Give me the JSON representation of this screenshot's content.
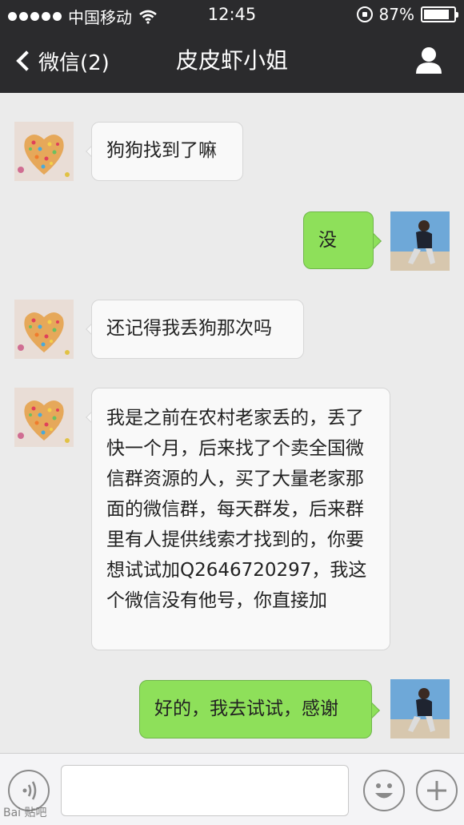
{
  "status_bar": {
    "carrier": "中国移动",
    "time": "12:45",
    "battery_percent": "87%",
    "battery_level": 0.87
  },
  "nav": {
    "back_label": "微信(2)",
    "title": "皮皮虾小姐",
    "back_icon": "chevron-left-icon",
    "profile_icon": "person-icon"
  },
  "messages": [
    {
      "sender": "other",
      "text": "狗狗找到了嘛"
    },
    {
      "sender": "me",
      "text": "没"
    },
    {
      "sender": "other",
      "text": "还记得我丢狗那次吗"
    },
    {
      "sender": "other",
      "text": "我是之前在农村老家丢的，丢了快一个月，后来找了个卖全国微信群资源的人，买了大量老家那面的微信群，每天群发，后来群里有人提供线索才找到的，你要想试试加Q2646720297，我这个微信没有他号，你直接加"
    },
    {
      "sender": "me",
      "text": "好的，我去试试，感谢"
    }
  ],
  "input_bar": {
    "value": "",
    "voice_icon": "voice-icon",
    "emoji_icon": "smiley-icon",
    "add_icon": "plus-icon",
    "watermark": "Bai 贴吧"
  },
  "colors": {
    "header_bg": "#2b2b2d",
    "chat_bg": "#ebebeb",
    "bubble_in": "#f9f9f9",
    "bubble_out": "#8ee05a"
  }
}
